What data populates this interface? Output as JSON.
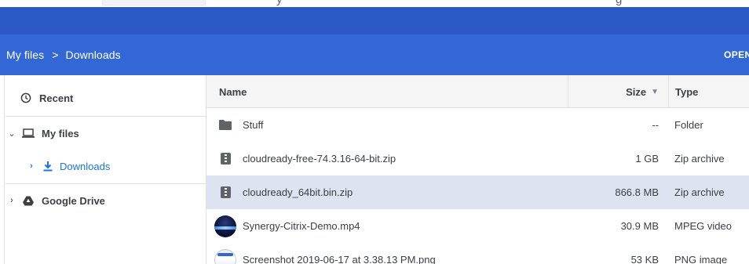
{
  "top_strip": {
    "partial_text": "y",
    "partial_text_right": "g"
  },
  "breadcrumb": {
    "root": "My files",
    "separator": ">",
    "current": "Downloads"
  },
  "header": {
    "open_label": "OPEN"
  },
  "sidebar": {
    "recent": "Recent",
    "my_files": "My files",
    "downloads": "Downloads",
    "google_drive": "Google Drive"
  },
  "columns": {
    "name": "Name",
    "size": "Size",
    "sort_arrow": "▼",
    "type": "Type"
  },
  "files": [
    {
      "name": "Stuff",
      "size": "--",
      "type": "Folder",
      "icon": "folder-icon"
    },
    {
      "name": "cloudready-free-74.3.16-64-bit.zip",
      "size": "1 GB",
      "type": "Zip archive",
      "icon": "zip-archive-icon"
    },
    {
      "name": "cloudready_64bit.bin.zip",
      "size": "866.8 MB",
      "type": "Zip archive",
      "icon": "zip-archive-icon",
      "selected": true
    },
    {
      "name": "Synergy-Citrix-Demo.mp4",
      "size": "30.9 MB",
      "type": "MPEG video",
      "icon": "video-thumbnail"
    },
    {
      "name": "Screenshot 2019-06-17 at 3.38.13 PM.png",
      "size": "53 KB",
      "type": "PNG image",
      "icon": "image-thumbnail"
    }
  ],
  "colors": {
    "titlebar": "#2c59c5",
    "header": "#3367d6",
    "selection": "#dde3f0",
    "active_nav": "#1a73e8"
  }
}
